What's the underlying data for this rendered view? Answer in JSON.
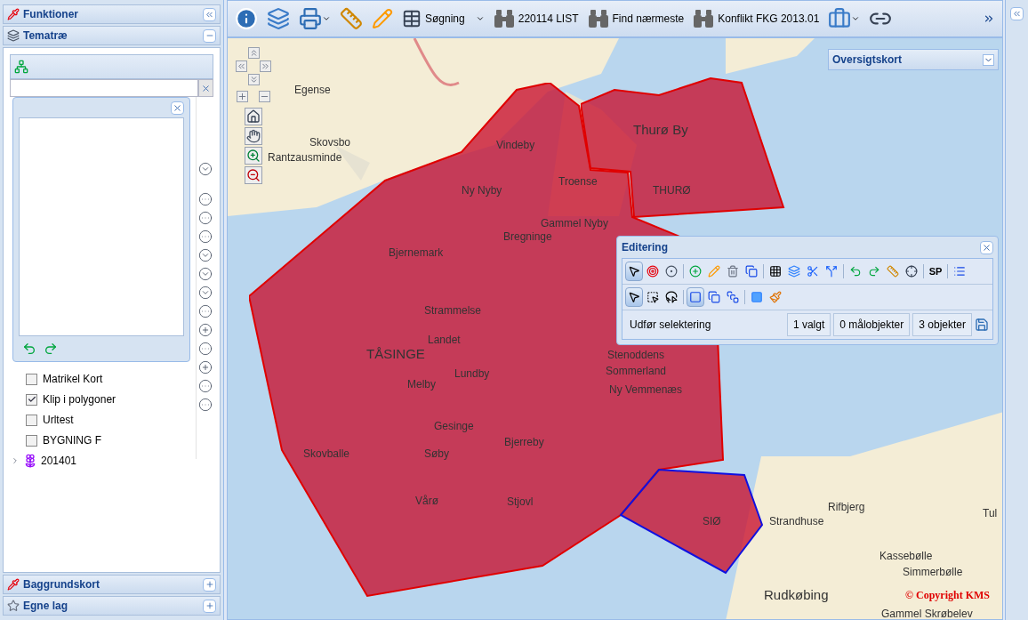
{
  "sidebar": {
    "title": "Funktioner",
    "sections": [
      {
        "title": "Tematræ",
        "expanded": true
      },
      {
        "title": "Baggrundskort",
        "expanded": false
      },
      {
        "title": "Egne lag",
        "expanded": false
      }
    ],
    "layers": [
      {
        "label": "Matrikel Kort",
        "checked": false
      },
      {
        "label": "Klip i polygoner",
        "checked": true
      },
      {
        "label": "Urltest",
        "checked": false
      },
      {
        "label": "BYGNING F",
        "checked": false
      }
    ],
    "tree_node": {
      "label": "201401",
      "expanded": false
    }
  },
  "toolbar": {
    "buttons": [
      {
        "label": "Søgning",
        "kind": "search-table",
        "dropdown": true
      },
      {
        "label": "220114 LIST",
        "kind": "binoculars",
        "dropdown": false
      },
      {
        "label": "Find nærmeste",
        "kind": "binoculars",
        "dropdown": false
      },
      {
        "label": "Konflikt FKG 2013.01",
        "kind": "binoculars",
        "dropdown": false
      }
    ]
  },
  "overview": {
    "title": "Oversigtskort"
  },
  "editing": {
    "title": "Editering",
    "tools_row1": [
      {
        "kind": "pointer",
        "selected": true
      },
      {
        "kind": "target",
        "selected": false
      },
      {
        "kind": "multi-target",
        "selected": false
      },
      {
        "kind": "sep"
      },
      {
        "kind": "add",
        "selected": false
      },
      {
        "kind": "pencil",
        "selected": false
      },
      {
        "kind": "trash",
        "selected": false
      },
      {
        "kind": "copy",
        "selected": false
      },
      {
        "kind": "sep"
      },
      {
        "kind": "grid",
        "selected": false
      },
      {
        "kind": "layers",
        "selected": false
      },
      {
        "kind": "scissors",
        "selected": false
      },
      {
        "kind": "split",
        "selected": false
      },
      {
        "kind": "sep"
      },
      {
        "kind": "undo",
        "selected": false
      },
      {
        "kind": "redo",
        "selected": false
      },
      {
        "kind": "ruler",
        "selected": false
      },
      {
        "kind": "crosshair",
        "selected": false
      },
      {
        "kind": "sep"
      },
      {
        "kind": "text",
        "label": "SP",
        "selected": false
      },
      {
        "kind": "sep"
      },
      {
        "kind": "list",
        "selected": false
      }
    ],
    "tools_row2": [
      {
        "kind": "pointer",
        "selected": true
      },
      {
        "kind": "box-select",
        "selected": false
      },
      {
        "kind": "lasso",
        "selected": false
      },
      {
        "kind": "sep"
      },
      {
        "kind": "square",
        "selected": true
      },
      {
        "kind": "union",
        "selected": false
      },
      {
        "kind": "difference",
        "selected": false
      },
      {
        "kind": "sep"
      },
      {
        "kind": "fill",
        "selected": false
      },
      {
        "kind": "broom",
        "selected": false
      }
    ],
    "status": "Udfør selektering",
    "counts": [
      "1 valgt",
      "0 målobjekter",
      "3 objekter"
    ]
  },
  "map": {
    "labels": [
      "Egense",
      "Skovsbo",
      "Rantzausminde",
      "Vindeby",
      "Thurø By",
      "Troense",
      "THURØ",
      "Ny Nyby",
      "Gammel Nyby",
      "Bregninge",
      "Bjernemark",
      "Strammelse",
      "Landet",
      "TÅSINGE",
      "Stenoddens Sommerland",
      "Lundby",
      "Melby",
      "Ny Vemmenæs",
      "Gesinge",
      "Bjerreby",
      "Skovballe",
      "Søby",
      "Vårø",
      "Stjovl",
      "SIØ",
      "Strandhuse",
      "Rifbjerg",
      "Kassebølle",
      "Simmerbølle",
      "Rudkøbing",
      "Gammel Skrøbelev",
      "Tul"
    ],
    "copyright": "© Copyright KMS"
  }
}
